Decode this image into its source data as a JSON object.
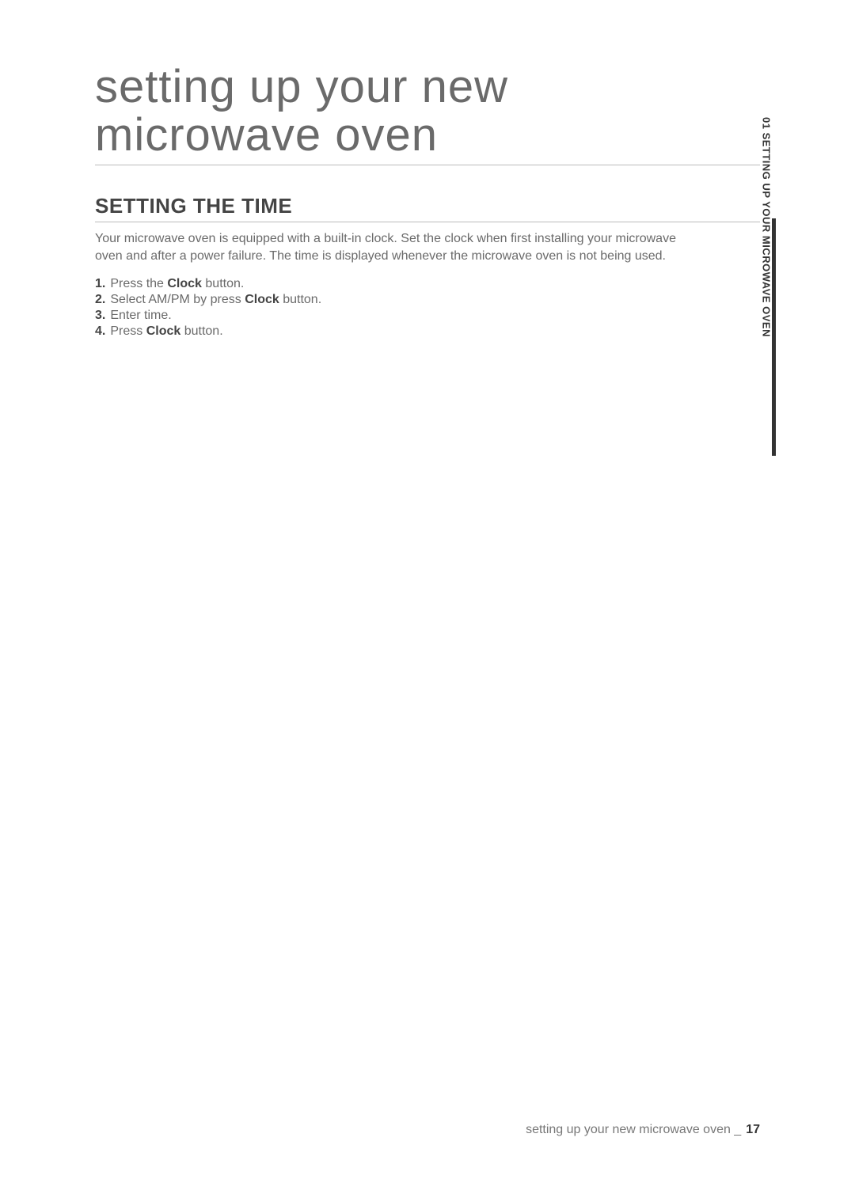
{
  "chapter_title_line1": "setting up your new",
  "chapter_title_line2": "microwave oven",
  "section_title": "SETTING THE TIME",
  "intro": "Your microwave oven is equipped with a built-in clock. Set the clock when first installing your microwave oven and after a power failure. The time is displayed whenever the microwave oven is not being used.",
  "steps": {
    "s1_num": "1.",
    "s1_a": "Press the ",
    "s1_b": "Clock",
    "s1_c": " button.",
    "s2_num": "2.",
    "s2_a": "Select AM/PM by press ",
    "s2_b": "Clock",
    "s2_c": " button.",
    "s3_num": "3.",
    "s3_a": "Enter time.",
    "s4_num": "4.",
    "s4_a": "Press ",
    "s4_b": "Clock",
    "s4_c": " button."
  },
  "side_tab": "01 SETTING UP YOUR MICROWAVE OVEN",
  "footer_text": "setting up your new microwave oven _",
  "page_number": "17"
}
